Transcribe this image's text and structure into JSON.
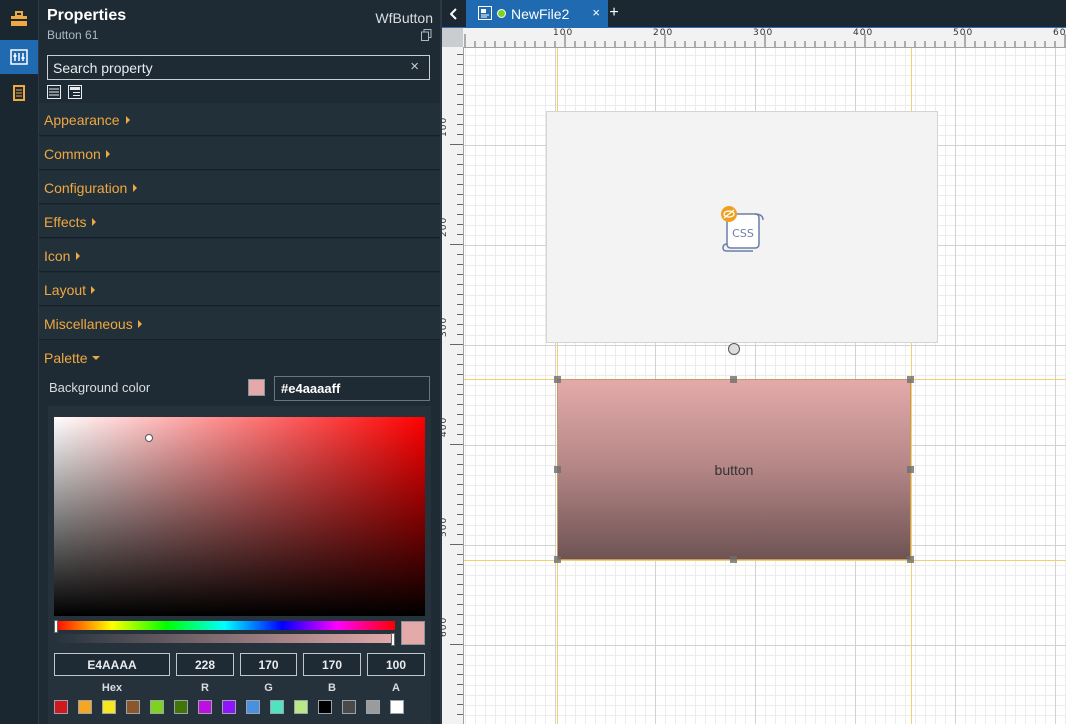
{
  "panel": {
    "title": "Properties",
    "subtitle": "Button 61",
    "type": "WfButton",
    "search_placeholder": "Search property",
    "search_clear": "×",
    "sections": [
      {
        "label": "Appearance",
        "expanded": false
      },
      {
        "label": "Common",
        "expanded": false
      },
      {
        "label": "Configuration",
        "expanded": false
      },
      {
        "label": "Effects",
        "expanded": false
      },
      {
        "label": "Icon",
        "expanded": false
      },
      {
        "label": "Layout",
        "expanded": false
      },
      {
        "label": "Miscellaneous",
        "expanded": false
      },
      {
        "label": "Palette",
        "expanded": true
      }
    ],
    "background_color_label": "Background color",
    "background_color_value": "#e4aaaaff",
    "background_color": "#e4aaaa"
  },
  "color_picker": {
    "hex": "E4AAAA",
    "r": "228",
    "g": "170",
    "b": "170",
    "a": "100",
    "labels": {
      "hex": "Hex",
      "r": "R",
      "g": "G",
      "b": "B",
      "a": "A"
    },
    "swatches": [
      "#d0191e",
      "#f5a623",
      "#f8e71c",
      "#8b572a",
      "#7ed321",
      "#417505",
      "#bd10e0",
      "#9013fe",
      "#4a90e2",
      "#50e3c2",
      "#b8e986",
      "#000000",
      "#4a4a4a",
      "#9b9b9b",
      "#ffffff"
    ]
  },
  "editor": {
    "tab_label": "NewFile2",
    "tab_close": "×",
    "tab_add": "+",
    "h_ruler": [
      "100",
      "200",
      "300",
      "400",
      "500",
      "60"
    ],
    "v_ruler": [
      "100",
      "200",
      "300",
      "400",
      "500",
      "600"
    ],
    "css_badge": "CSS",
    "button_text": "button"
  },
  "colors": {
    "accent": "#1f6ab0",
    "section_label": "#f0a840",
    "tab_dot": "#7ed321"
  }
}
